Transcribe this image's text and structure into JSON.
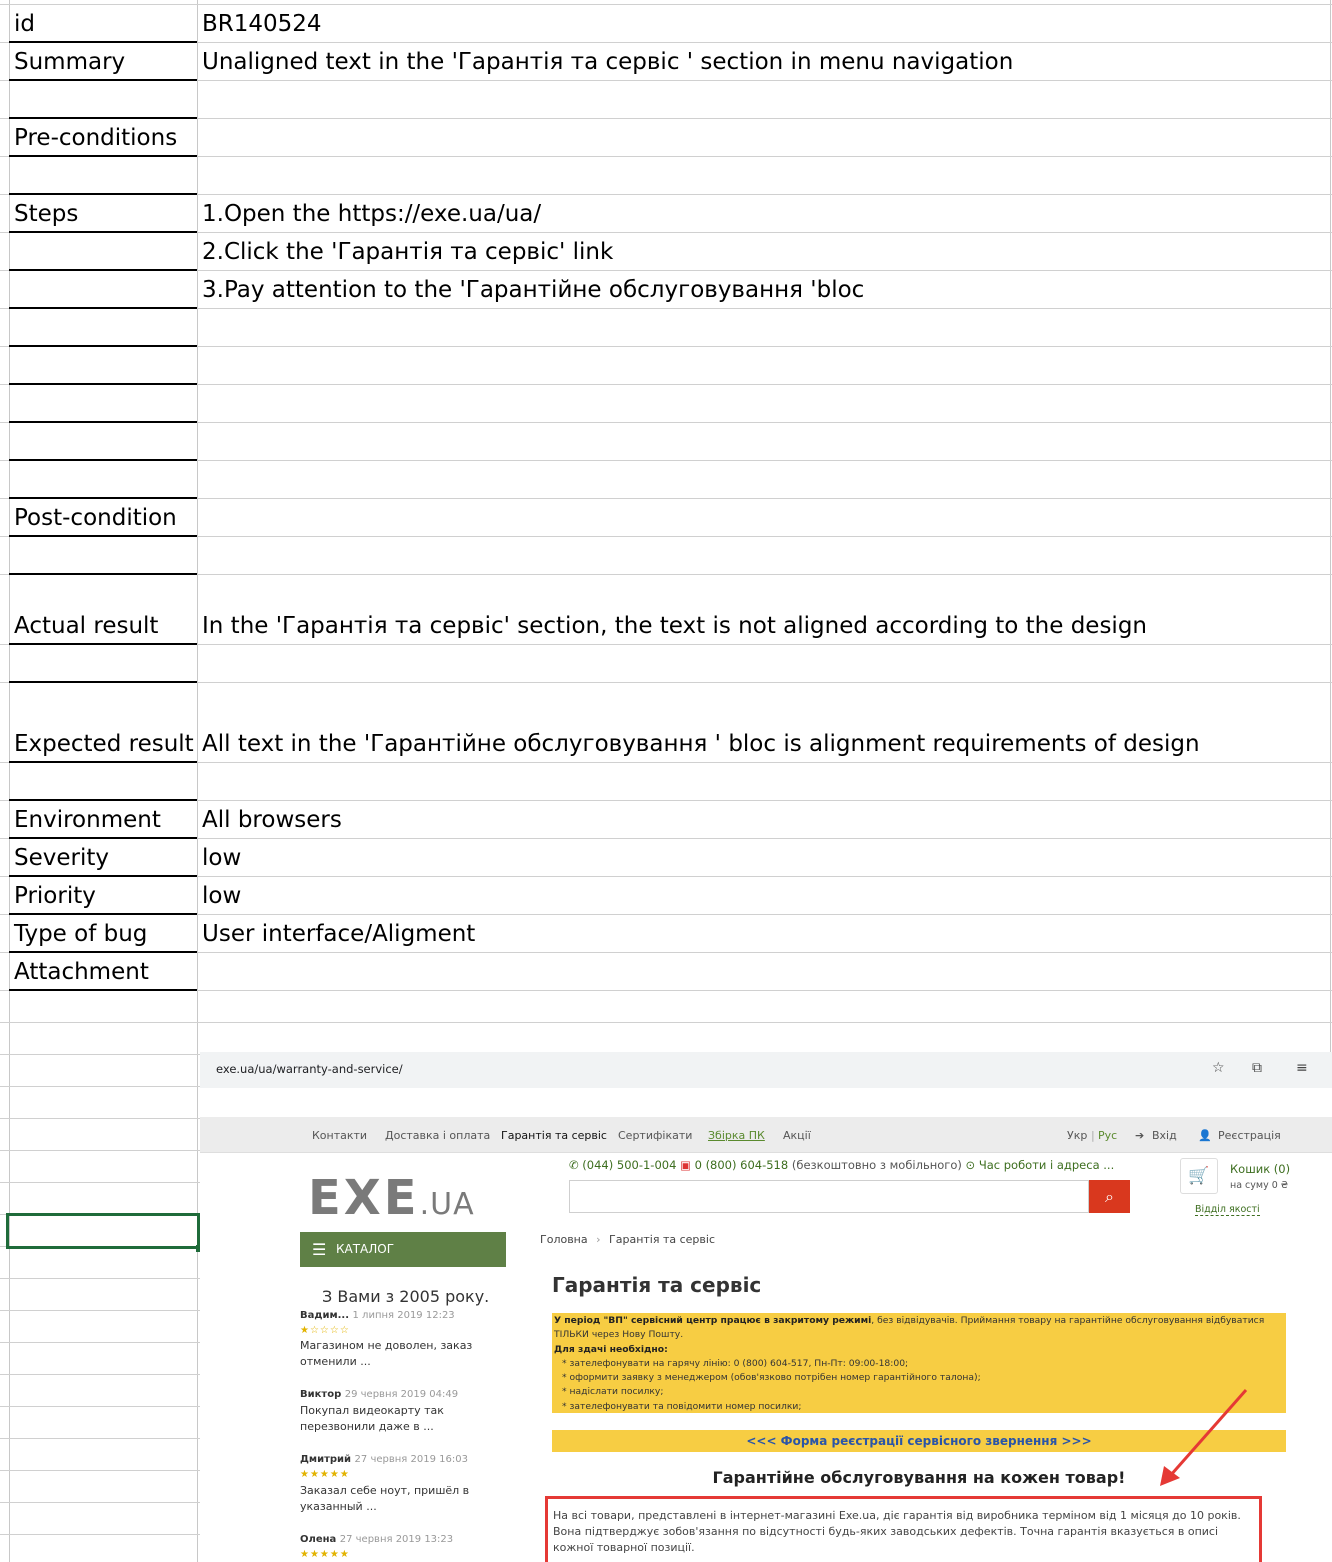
{
  "sheet": {
    "rows": [
      {
        "label": "id",
        "value": "BR140524"
      },
      {
        "label": "Summary",
        "value": "Unaligned text in the 'Гарантія та сервіс ' section in menu navigation"
      },
      {
        "label": "Pre-conditions",
        "value": ""
      },
      {
        "label": "Steps",
        "value": "1.Open the https://exe.ua/ua/"
      },
      {
        "label": "",
        "value": "2.Click the 'Гарантія та сервіс' link"
      },
      {
        "label": "",
        "value": "3.Pay attention to the 'Гарантійне обслуговування 'bloc"
      },
      {
        "label": "Post-condition",
        "value": ""
      },
      {
        "label": "Actual result",
        "value": "In the 'Гарантія та сервіс' section, the text is not aligned according to the design"
      },
      {
        "label": "Expected result",
        "value": "All text in the  'Гарантійне обслуговування ' bloc is alignment requirements of design"
      },
      {
        "label": "Environment",
        "value": "All browsers"
      },
      {
        "label": "Severity",
        "value": "low"
      },
      {
        "label": "Priority",
        "value": "low"
      },
      {
        "label": "Type of bug",
        "value": "User interface/Aligment"
      },
      {
        "label": "Attachment",
        "value": ""
      }
    ]
  },
  "browser": {
    "url": "exe.ua/ua/warranty-and-service/",
    "icons": [
      "star-icon",
      "extensions-icon",
      "media-icon"
    ]
  },
  "site": {
    "nav": [
      "Контакти",
      "Доставка і оплата",
      "Гарантія та сервіс",
      "Сертифікати",
      "Збірка ПК",
      "Акції"
    ],
    "lang_ukr": "Укр",
    "lang_sep": "|",
    "lang_rus": "Рус",
    "login": "Вхід",
    "register": "Реєстрація",
    "logo_main": "EXE",
    "logo_suffix": ".UA",
    "phone1": "(044) 500-1-004",
    "phone2": "0 (800) 604-518",
    "phone_note": "(безкоштовно з мобільного)",
    "hours": "Час роботи і адреса ...",
    "cart_title": "Кошик (0)",
    "cart_sum": "на суму 0 ₴",
    "quality": "Відділ якості",
    "catalog": "КАТАЛОГ",
    "since": "З Вами з 2005 року.",
    "reviews": [
      {
        "name": "Вадим...",
        "date": "1 липня 2019 12:23",
        "stars": "★☆☆☆☆",
        "text": "Магазином не доволен, заказ отменили ..."
      },
      {
        "name": "Виктор",
        "date": "29 червня 2019 04:49",
        "stars": "",
        "text": "Покупал видеокарту так перезвонили даже в ..."
      },
      {
        "name": "Дмитрий",
        "date": "27 червня 2019 16:03",
        "stars": "★★★★★",
        "text": "Заказал себе ноут, пришёл в указанный ..."
      },
      {
        "name": "Олена",
        "date": "27 червня 2019 13:23",
        "stars": "★★★★★",
        "text": ""
      }
    ],
    "breadcrumb_home": "Головна",
    "breadcrumb_sep": "›",
    "breadcrumb_current": "Гарантія та сервіс",
    "page_title": "Гарантія та сервіс",
    "notice_bold": "У період \"ВП\" сервісний центр працює в закритому режимі",
    "notice_rest": ", без відвідувачів. Приймання товару на гарантійне обслуговування відбуватися ТІЛЬКИ через Нову Пошту.",
    "notice_need": "Для здачі необхідно:",
    "notice_items": [
      "* зателефонувати на гарячу лінію: 0 (800) 604-517, Пн-Пт: 09:00-18:00;",
      "* оформити заявку з менеджером (обов'язково потрібен номер гарантійного талона);",
      "* надіслати посилку;",
      "* зателефонувати та повідомити номер посилки;"
    ],
    "form_link": "<<< Форма реєстрації сервісного звернення >>>",
    "warranty_title": "Гарантійне обслуговування на кожен товар!",
    "warranty_text": "На всі товари, представлені в інтернет-магазині Exe.ua, діє гарантія від виробника терміном від 1 місяця до 10 років. Вона підтверджує зобов'язання по відсутності будь-яких заводських дефектів. Точна гарантія вказується в описі кожної товарної позиції."
  },
  "colors": {
    "highlight": "#e53935",
    "notice_bg": "#f7cd43",
    "brand_green": "#5f8046"
  }
}
